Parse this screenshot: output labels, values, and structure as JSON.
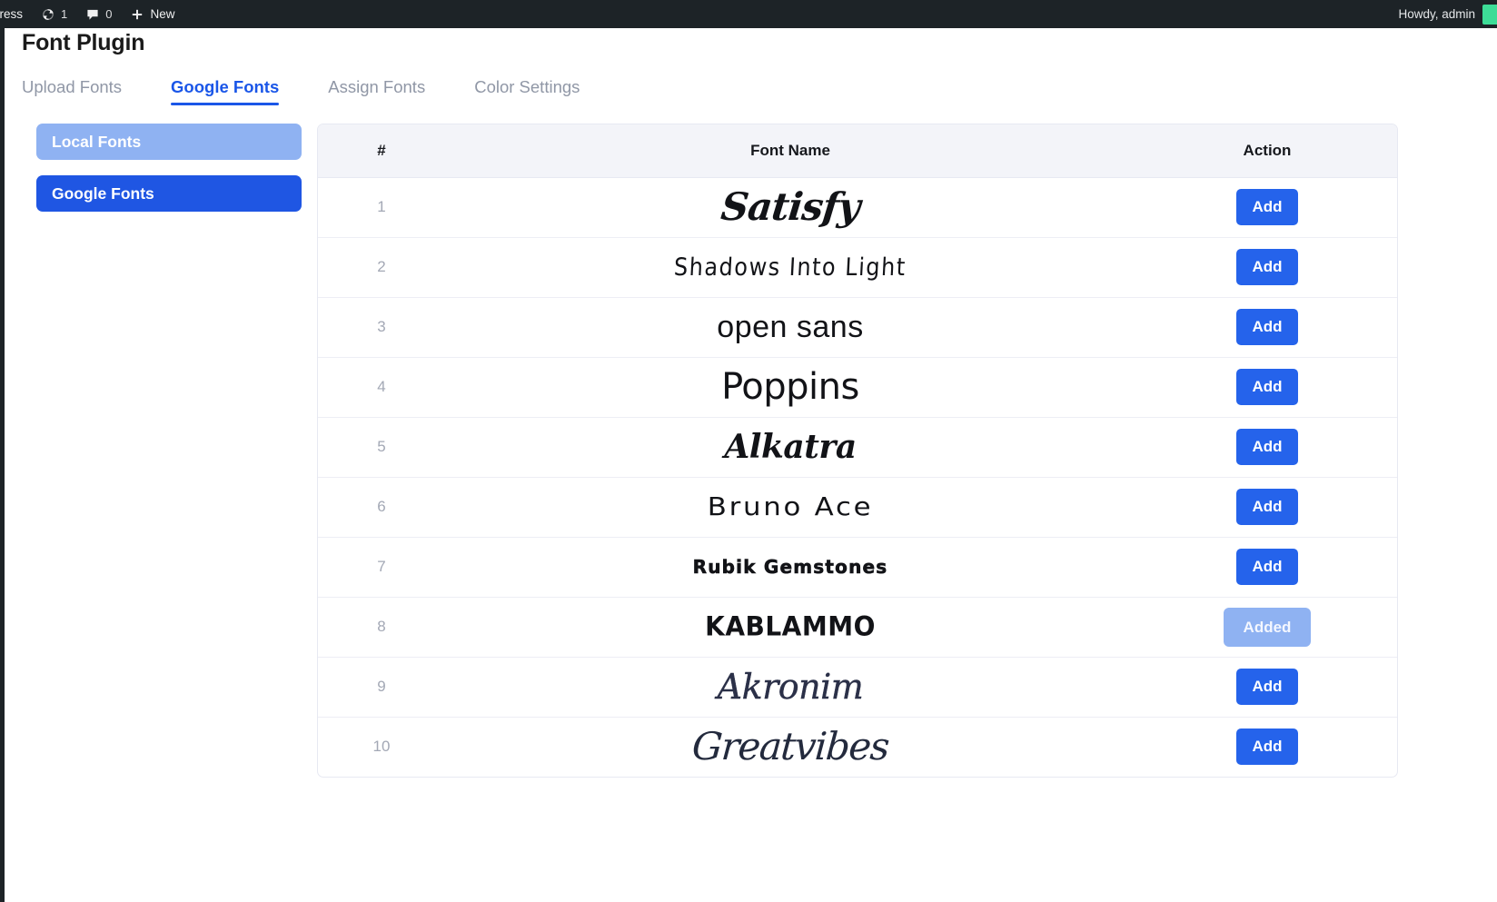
{
  "adminbar": {
    "site_label": "press",
    "updates": {
      "icon": "updates-icon",
      "count": "1"
    },
    "comments": {
      "icon": "comment-icon",
      "count": "0"
    },
    "new": {
      "icon": "plus-icon",
      "label": "New"
    },
    "howdy": "Howdy, admin"
  },
  "page": {
    "title": "Font Plugin"
  },
  "tabs": [
    {
      "label": "Upload Fonts",
      "active": false
    },
    {
      "label": "Google Fonts",
      "active": true
    },
    {
      "label": "Assign Fonts",
      "active": false
    },
    {
      "label": "Color Settings",
      "active": false
    }
  ],
  "sidebar": {
    "items": [
      {
        "label": "Local Fonts",
        "state": "inactive"
      },
      {
        "label": "Google Fonts",
        "state": "active"
      }
    ]
  },
  "table": {
    "headers": [
      "#",
      "Font Name",
      "Action"
    ],
    "rows": [
      {
        "num": "1",
        "font": "Satisfy",
        "action": "Add",
        "added": false
      },
      {
        "num": "2",
        "font": "Shadows Into Light",
        "action": "Add",
        "added": false
      },
      {
        "num": "3",
        "font": "open sans",
        "action": "Add",
        "added": false
      },
      {
        "num": "4",
        "font": "Poppins",
        "action": "Add",
        "added": false
      },
      {
        "num": "5",
        "font": "Alkatra",
        "action": "Add",
        "added": false
      },
      {
        "num": "6",
        "font": "Bruno Ace",
        "action": "Add",
        "added": false
      },
      {
        "num": "7",
        "font": "Rubik Gemstones",
        "action": "Add",
        "added": false
      },
      {
        "num": "8",
        "font": "KABLAMMO",
        "action": "Added",
        "added": true
      },
      {
        "num": "9",
        "font": "Akronim",
        "action": "Add",
        "added": false
      },
      {
        "num": "10",
        "font": "Greatvibes",
        "action": "Add",
        "added": false
      }
    ]
  },
  "colors": {
    "accent": "#2563eb",
    "accent_soft": "#8fb2f2",
    "adminbar_bg": "#1d2327",
    "table_header_bg": "#f3f4f9",
    "avatar": "#3ddc97"
  }
}
